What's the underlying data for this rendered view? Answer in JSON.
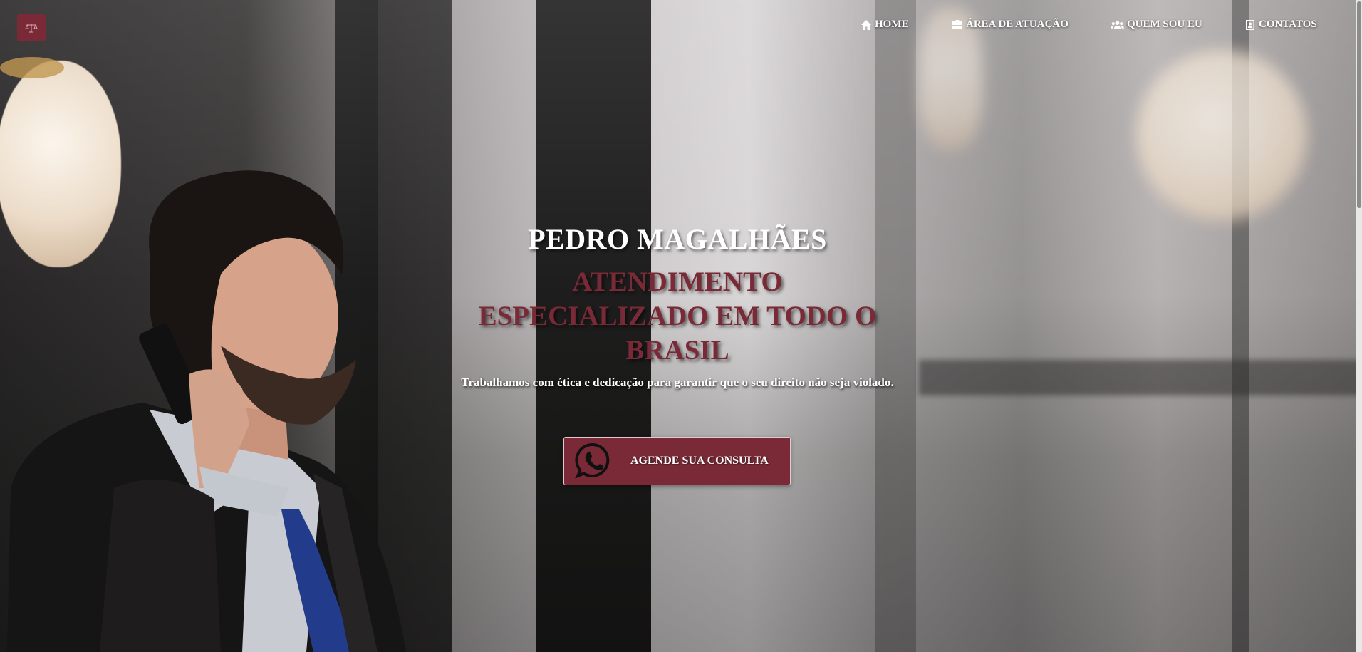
{
  "brand": {
    "logo_icon": "scales-icon",
    "color": "#7a2a36"
  },
  "nav": {
    "items": [
      {
        "label": "HOME",
        "icon": "home-icon"
      },
      {
        "label": "ÁREA DE ATUAÇÃO",
        "icon": "briefcase-icon"
      },
      {
        "label": "QUEM SOU EU",
        "icon": "users-icon"
      },
      {
        "label": "CONTATOS",
        "icon": "contact-card-icon"
      }
    ]
  },
  "hero": {
    "name": "PEDRO MAGALHÃES",
    "title": "ATENDIMENTO ESPECIALIZADO EM TODO O BRASIL",
    "subtitle": "Trabalhamos com ética e dedicação para garantir que o seu direito não seja violado.",
    "cta": {
      "label": "AGENDE SUA CONSULTA",
      "icon": "whatsapp-icon"
    }
  },
  "colors": {
    "accent": "#7a2a36",
    "text": "#ffffff"
  }
}
